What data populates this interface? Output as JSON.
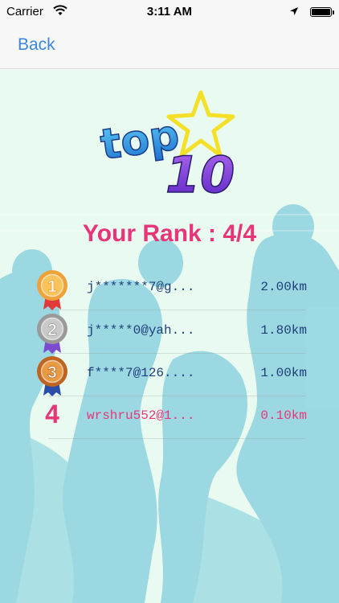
{
  "status_bar": {
    "carrier": "Carrier",
    "time": "3:11 AM"
  },
  "nav": {
    "back_label": "Back"
  },
  "logo": {
    "top_text": "top",
    "ten_text": "10"
  },
  "rank_title": "Your Rank : 4/4",
  "ranking": [
    {
      "rank": "1",
      "user": "j*******7@g...",
      "distance": "2.00km",
      "medal": "gold"
    },
    {
      "rank": "2",
      "user": "j*****0@yah...",
      "distance": "1.80km",
      "medal": "silver"
    },
    {
      "rank": "3",
      "user": "f****7@126....",
      "distance": "1.00km",
      "medal": "bronze"
    },
    {
      "rank": "4",
      "user": "wrshru552@1...",
      "distance": "0.10km",
      "medal": "none"
    }
  ],
  "colors": {
    "accent": "#e8357a",
    "link": "#3b86e0",
    "text": "#1d3f7a",
    "background": "#e9fbf1",
    "silhouette": "#8fd3e0"
  },
  "icons": [
    "wifi-icon",
    "location-arrow-icon",
    "battery-icon",
    "gold-medal-icon",
    "silver-medal-icon",
    "bronze-medal-icon"
  ]
}
